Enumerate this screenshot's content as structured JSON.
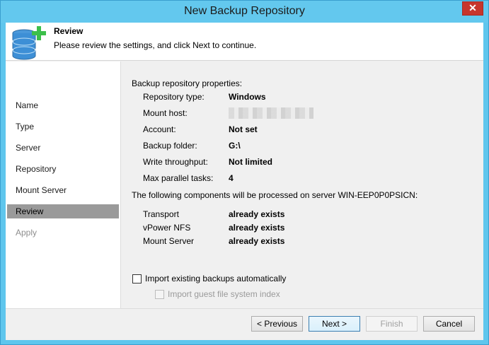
{
  "window": {
    "title": "New Backup Repository",
    "close_glyph": "✕"
  },
  "header": {
    "icon": "database-add-icon",
    "title": "Review",
    "subtitle": "Please review the settings, and click Next to continue."
  },
  "sidebar": {
    "items": [
      {
        "label": "Name",
        "state": "normal"
      },
      {
        "label": "Type",
        "state": "normal"
      },
      {
        "label": "Server",
        "state": "normal"
      },
      {
        "label": "Repository",
        "state": "normal"
      },
      {
        "label": "Mount Server",
        "state": "normal"
      },
      {
        "label": "Review",
        "state": "active"
      },
      {
        "label": "Apply",
        "state": "disabled"
      }
    ]
  },
  "review": {
    "section_title": "Backup repository properties:",
    "properties": [
      {
        "label": "Repository type:",
        "value": "Windows"
      },
      {
        "label": "Mount host:",
        "value": ""
      },
      {
        "label": "Account:",
        "value": "Not set"
      },
      {
        "label": "Backup folder:",
        "value": "G:\\"
      },
      {
        "label": "Write throughput:",
        "value": "Not limited"
      },
      {
        "label": "Max parallel tasks:",
        "value": "4"
      }
    ],
    "components_title": "The following components will be processed on server WIN-EEP0P0PSICN:",
    "components": [
      {
        "name": "Transport",
        "status": "already exists"
      },
      {
        "name": "vPower NFS",
        "status": "already exists"
      },
      {
        "name": "Mount Server",
        "status": "already exists"
      }
    ],
    "import_backups_label": "Import existing backups automatically",
    "import_index_label": "Import guest file system index"
  },
  "buttons": {
    "previous": "< Previous",
    "next": "Next >",
    "finish": "Finish",
    "cancel": "Cancel"
  },
  "colors": {
    "titlebar": "#63c8ee",
    "close": "#c7352c",
    "active_nav": "#9a9a9a",
    "icon_green": "#3cbf4a",
    "icon_blue": "#3d8fd6"
  }
}
